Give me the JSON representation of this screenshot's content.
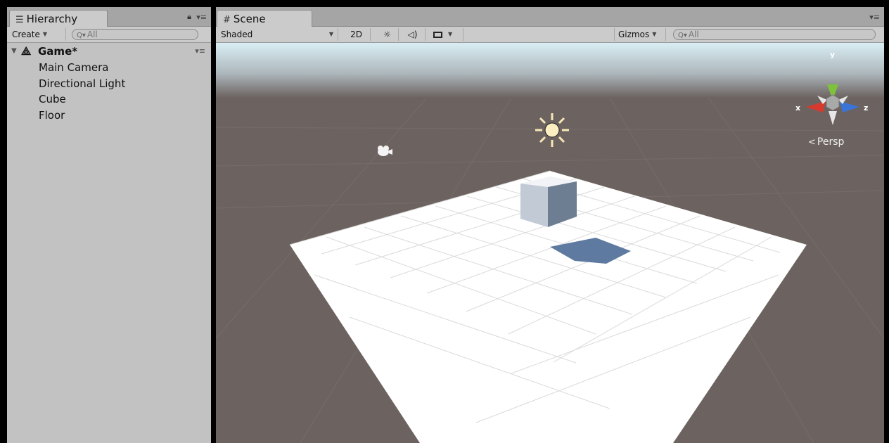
{
  "hierarchy": {
    "tab_label": "Hierarchy",
    "tab_icon": "hierarchy-list-icon",
    "create_label": "Create",
    "search_placeholder": "All",
    "root": {
      "name": "Game*",
      "icon": "unity-logo-icon",
      "expanded": true
    },
    "items": [
      "Main Camera",
      "Directional Light",
      "Cube",
      "Floor"
    ]
  },
  "scene": {
    "tab_label": "Scene",
    "tab_icon": "scene-grid-icon",
    "shading_mode": "Shaded",
    "mode_2d_label": "2D",
    "gizmos_label": "Gizmos",
    "search_placeholder": "All",
    "projection_label": "Persp",
    "axis": {
      "x": "x",
      "y": "y",
      "z": "z"
    },
    "colors": {
      "sky": "#c2dbe6",
      "ground": "#6c6360",
      "floor": "#ffffff",
      "cube_light": "#c2cad6",
      "cube_dark": "#6d7d92",
      "shadow": "#5f7aa0",
      "axis_x": "#d8392e",
      "axis_y": "#7ec23a",
      "axis_z": "#3a74d6"
    }
  }
}
